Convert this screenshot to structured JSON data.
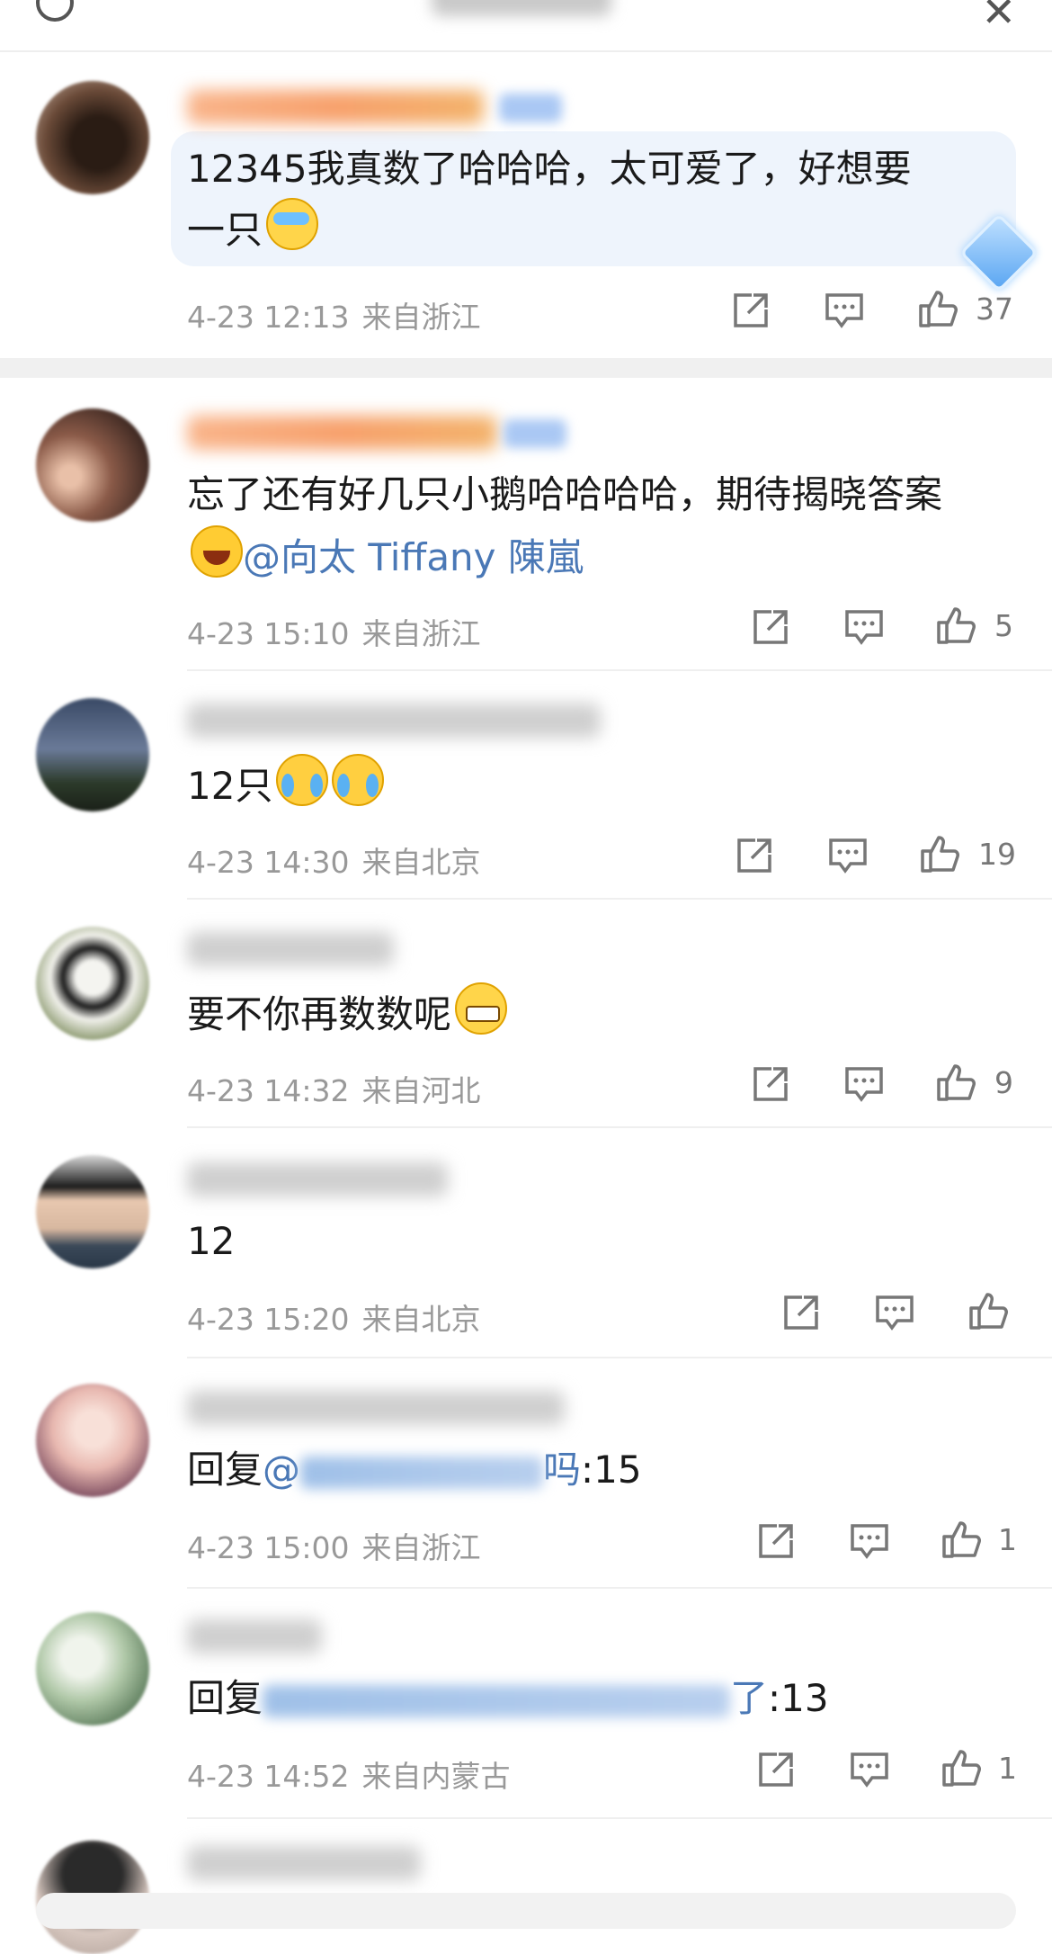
{
  "comments": [
    {
      "text": "12345我真数了哈哈哈，太可爱了，好想要",
      "text_line2": "一只",
      "emoji_line2": "tear-emoji",
      "time": "4-23 12:13",
      "location": "来自浙江",
      "likes": "37",
      "highlighted": true
    },
    {
      "text": "忘了还有好几只小鹅哈哈哈哈，期待揭晓答案",
      "mention": "@向太 Tiffany 陳嵐",
      "time": "4-23 15:10",
      "location": "来自浙江",
      "likes": "5"
    },
    {
      "text": "12只",
      "time": "4-23 14:30",
      "location": "来自北京",
      "likes": "19"
    },
    {
      "text": "要不你再数数呢",
      "time": "4-23 14:32",
      "location": "来自河北",
      "likes": "9"
    },
    {
      "text": "12",
      "time": "4-23 15:20",
      "location": "来自北京",
      "likes": ""
    },
    {
      "text_prefix": "回复",
      "text_at": "@",
      "text_mention_tail": "吗",
      "text_suffix": ":15",
      "time": "4-23 15:00",
      "location": "来自浙江",
      "likes": "1"
    },
    {
      "text_prefix": "回复",
      "text_mention_tail": "了",
      "text_suffix": ":13",
      "time": "4-23 14:52",
      "location": "来自内蒙古",
      "likes": "1"
    }
  ],
  "colors": {
    "accent_mention": "#4a78b6",
    "meta_gray": "#999999",
    "highlight_bg": "#eef4fc",
    "username_orange": "#f7a06b"
  },
  "icons": [
    "back-icon",
    "close-icon",
    "share-icon",
    "comment-icon",
    "like-icon",
    "diamond-icon"
  ]
}
